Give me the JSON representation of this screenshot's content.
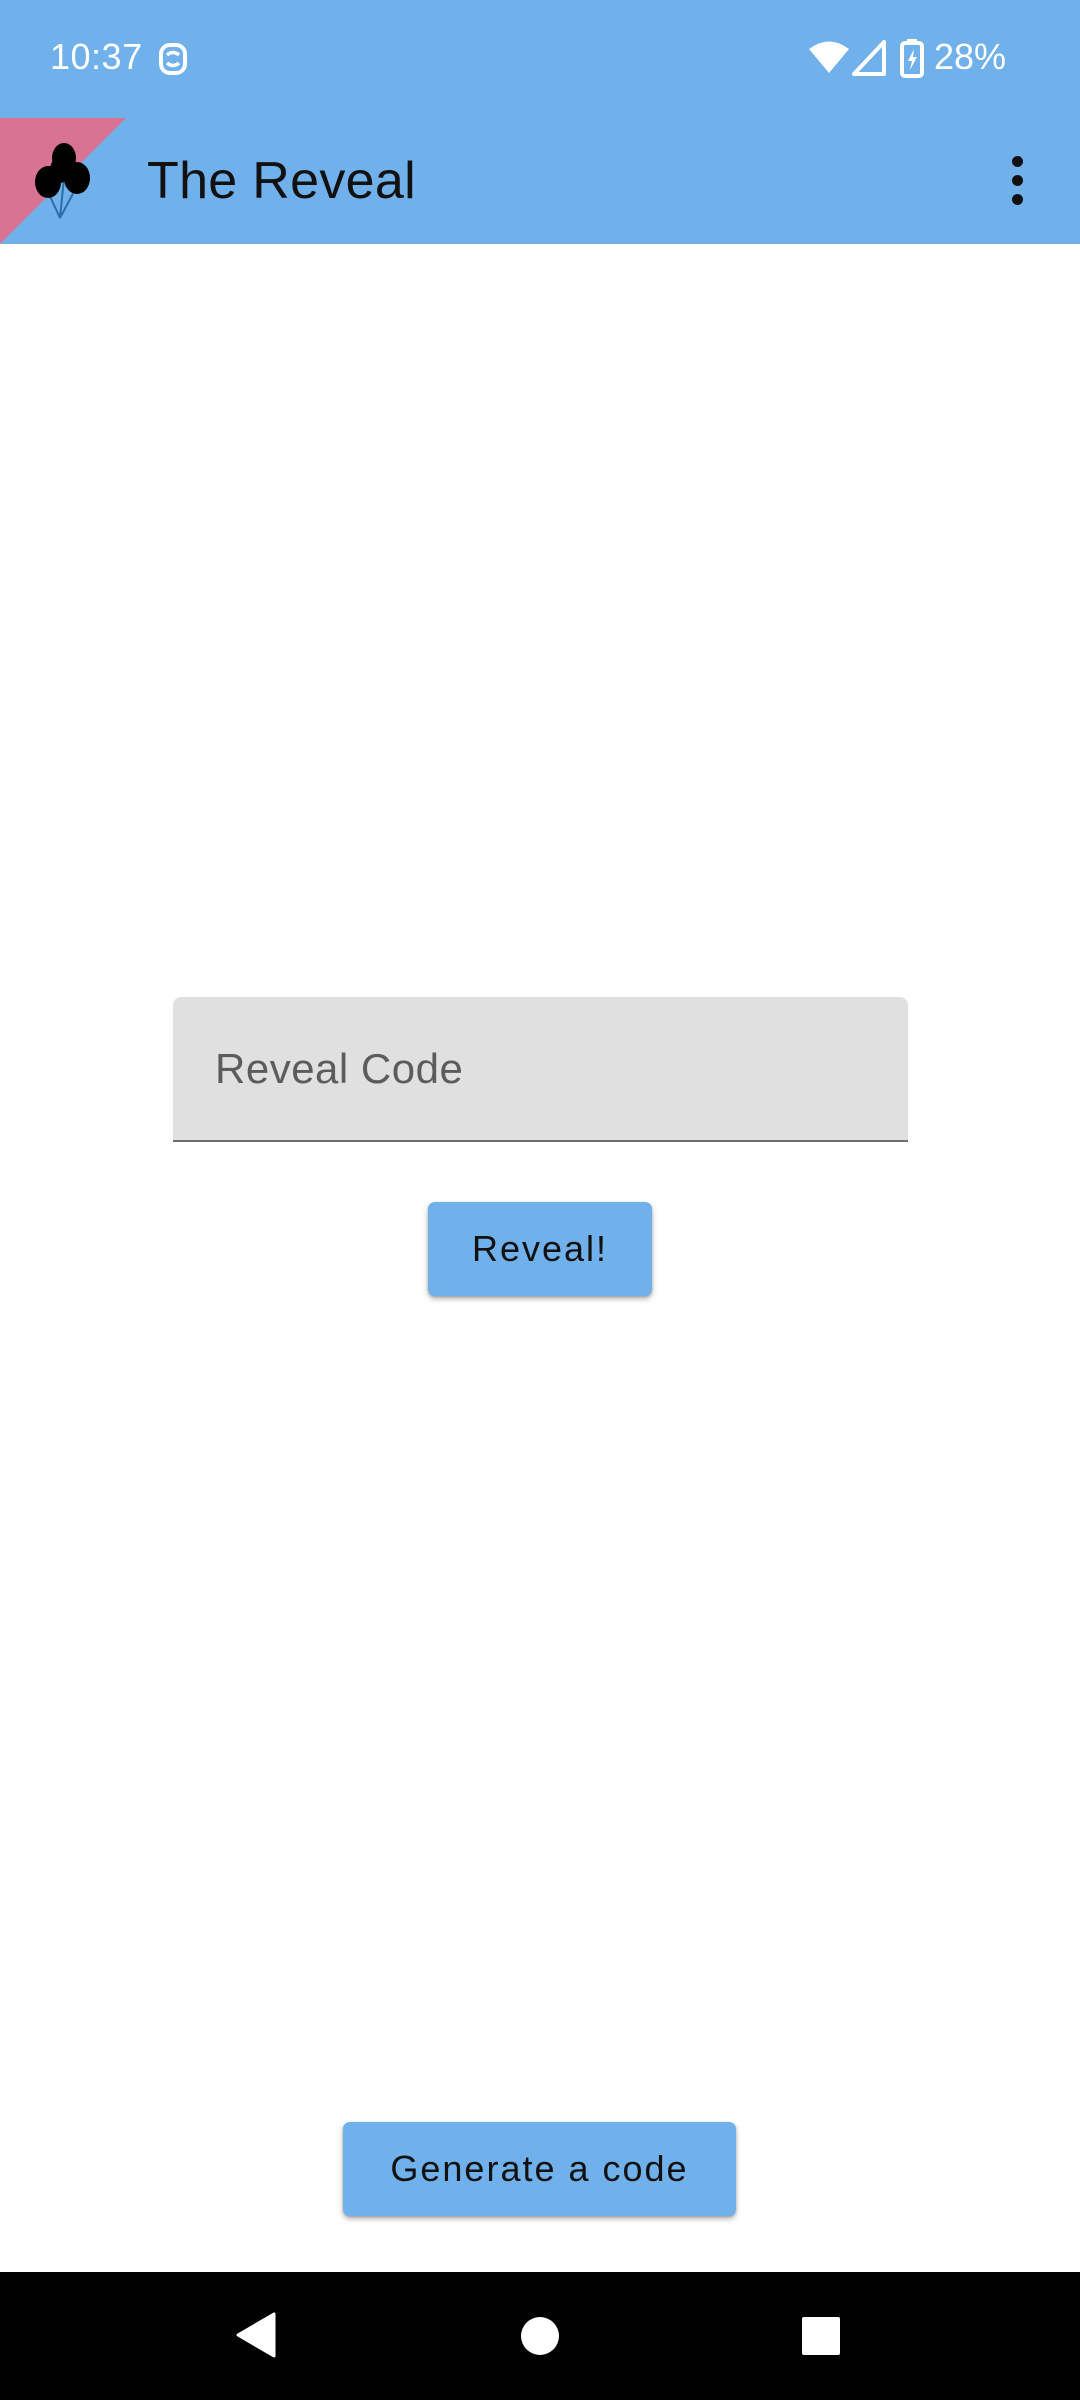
{
  "status_bar": {
    "time": "10:37",
    "battery": "28%",
    "icons": [
      "notification-icon",
      "wifi-icon",
      "cell-signal-icon",
      "battery-charging-icon"
    ]
  },
  "app_bar": {
    "title": "The Reveal",
    "logo_icon": "balloons-icon",
    "menu_icon": "overflow-menu-icon",
    "colors": {
      "background": "#70b0eb",
      "logo_accent": "#d97393"
    }
  },
  "main": {
    "code_field": {
      "placeholder": "Reveal Code",
      "value": ""
    },
    "reveal_button": "Reveal!",
    "generate_button": "Generate a code"
  },
  "nav_bar": {
    "icons": [
      "back-icon",
      "home-icon",
      "recents-icon"
    ]
  },
  "colors": {
    "accent": "#70b0eb",
    "field_background": "#e0e0e0",
    "nav_background": "#000000"
  }
}
